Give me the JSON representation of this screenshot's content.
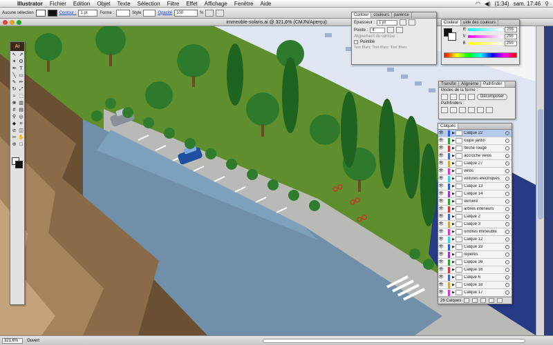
{
  "menubar": {
    "app": "Illustrator",
    "items": [
      "Fichier",
      "Edition",
      "Objet",
      "Texte",
      "Sélection",
      "Filtre",
      "Effet",
      "Affichage",
      "Fenêtre",
      "Aide"
    ],
    "battery": "(1:34)",
    "clock": "sam. 17:46"
  },
  "controlbar": {
    "selection": "Aucune sélection",
    "stroke_label": "Contour :",
    "stroke_weight": "1 pt",
    "shape_label": "Forme :",
    "style_label": "Style",
    "opacity_label": "Opacité",
    "opacity_value": "100",
    "percent": "%"
  },
  "document": {
    "title": "immeuble-solaris.ai @ 321,6% (CMJN/Aperçu)"
  },
  "toolbox": {
    "logo": "Ai"
  },
  "contour_panel": {
    "tabs": [
      "Contour",
      "couleurs",
      "parence"
    ],
    "epaisseur_label": "Epaisseur :",
    "epaisseur_value": "1 pt",
    "pointe_label": "Pointe :",
    "pointe_value": "4",
    "alignement_label": "Alignement du contour :",
    "pointille_label": "Pointillé",
    "dash_labels": [
      "Tiret",
      "Blanc",
      "Tiret",
      "Blanc",
      "Tiret",
      "Blanc"
    ]
  },
  "couleur_panel": {
    "tabs": [
      "Couleur",
      "uide des couleurs"
    ],
    "channels": [
      {
        "label": "R",
        "value": "255"
      },
      {
        "label": "V",
        "value": "255"
      },
      {
        "label": "B",
        "value": "255"
      }
    ]
  },
  "pathfinder_panel": {
    "tabs": [
      "Transfor",
      "Aligneme",
      "Pathfinder"
    ],
    "modes_label": "Modes de la forme :",
    "decompose_label": "Décomposer",
    "pathfinders_label": "Pathfinders :"
  },
  "layers_panel": {
    "tab": "Calques",
    "count_label": "26 Calques",
    "layers": [
      {
        "name": "Calque 22",
        "color": "#2c5de0",
        "selected": true
      },
      {
        "name": "loupe jardin",
        "color": "#3aa03a"
      },
      {
        "name": "flèche rouge",
        "color": "#d23a3a"
      },
      {
        "name": "accroche velos",
        "color": "#3a6bd2"
      },
      {
        "name": "Calque 27",
        "color": "#d2a53a"
      },
      {
        "name": "velos",
        "color": "#d23ad2"
      },
      {
        "name": "voitures electriques",
        "color": "#3ad2d2"
      },
      {
        "name": "Calque 13",
        "color": "#2c5de0"
      },
      {
        "name": "Calque 14",
        "color": "#9a3ad2"
      },
      {
        "name": "verriere",
        "color": "#3aa03a"
      },
      {
        "name": "arbres interieurs",
        "color": "#d23a3a"
      },
      {
        "name": "Calque 2",
        "color": "#3a6bd2"
      },
      {
        "name": "Calque 3",
        "color": "#d2a53a"
      },
      {
        "name": "ombres immeuble",
        "color": "#d23ad2"
      },
      {
        "name": "Calque 12",
        "color": "#3ad2d2"
      },
      {
        "name": "Calque 19",
        "color": "#2c5de0"
      },
      {
        "name": "repères",
        "color": "#9a3ad2"
      },
      {
        "name": "Calque 26",
        "color": "#3aa03a"
      },
      {
        "name": "Calque 16",
        "color": "#d23a3a"
      },
      {
        "name": "Calque 6",
        "color": "#3a6bd2"
      },
      {
        "name": "Calque 18",
        "color": "#d2a53a"
      },
      {
        "name": "Calque 17",
        "color": "#d23ad2"
      }
    ]
  },
  "statusbar": {
    "zoom": "321,6%",
    "state": "Ouvert"
  }
}
